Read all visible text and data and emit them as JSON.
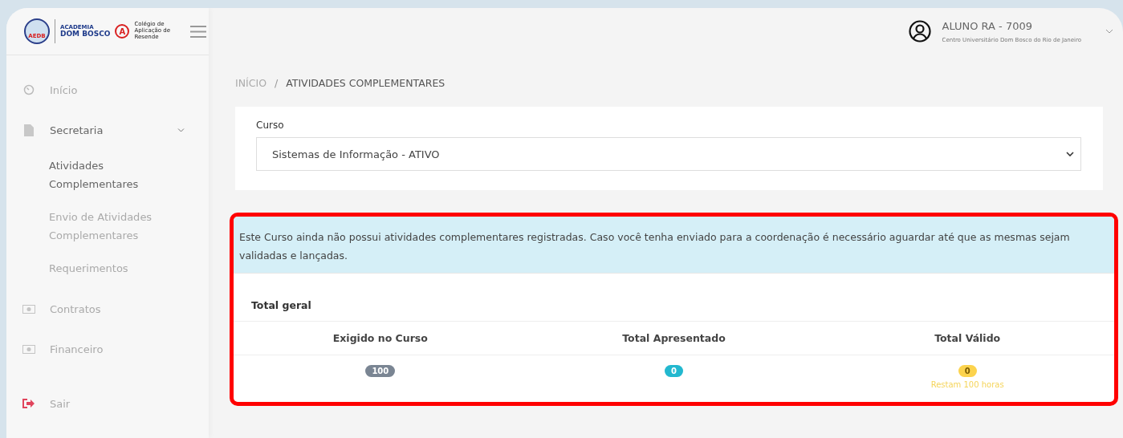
{
  "logo": {
    "seal": "AEDB",
    "brand_small": "ACADEMIA",
    "brand": "DOM BOSCO",
    "school_mark": "A",
    "school": "Colégio de Aplicação de Resende"
  },
  "user": {
    "name": "ALUNO RA - 7009",
    "institution": "Centro Universitário Dom Bosco do Rio de Janeiro"
  },
  "sidebar": {
    "items": [
      {
        "kind": "item",
        "label": "Início",
        "selected": false
      },
      {
        "kind": "group",
        "label": "Secretaria",
        "expanded": true,
        "children": [
          {
            "label": "Atividades Complementares",
            "selected": true
          },
          {
            "label": "Envio de Atividades Complementares",
            "selected": false
          },
          {
            "label": "Requerimentos",
            "selected": false
          }
        ]
      },
      {
        "kind": "item",
        "label": "Contratos",
        "selected": false
      },
      {
        "kind": "item",
        "label": "Financeiro",
        "selected": false
      },
      {
        "kind": "logout",
        "label": "Sair",
        "selected": false
      }
    ]
  },
  "breadcrumb": [
    "INÍCIO",
    "/",
    "ATIVIDADES COMPLEMENTARES"
  ],
  "course": {
    "label": "Curso",
    "value": "Sistemas de Informação - ATIVO"
  },
  "alert": "Este Curso ainda não possui atividades complementares registradas. Caso você tenha enviado para a coordenação é necessário aguardar até que as mesmas sejam validadas e lançadas.",
  "totals": {
    "title": "Total geral",
    "columns": [
      {
        "heading": "Exigido no Curso",
        "value": "100",
        "color": "#7a8593"
      },
      {
        "heading": "Total Apresentado",
        "value": "0",
        "color": "#22b8cf"
      },
      {
        "heading": "Total Válido",
        "value": "0",
        "color": "#fcd34d",
        "note": "Restam 100 horas"
      }
    ]
  }
}
